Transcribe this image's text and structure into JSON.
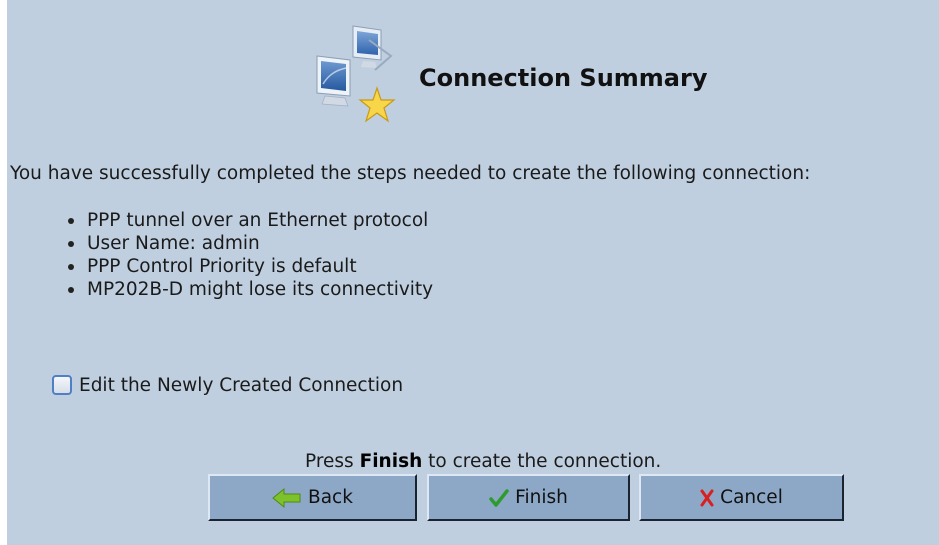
{
  "header": {
    "icon": "network-connection-wizard-icon",
    "title": "Connection Summary"
  },
  "summary": {
    "intro": "You have successfully completed the steps needed to create the following connection:",
    "items": [
      "PPP tunnel over an Ethernet protocol",
      "User Name: admin",
      "PPP Control Priority is default",
      "MP202B-D might lose its connectivity"
    ]
  },
  "edit_option": {
    "label": "Edit the Newly Created Connection",
    "checked": false
  },
  "finish_note": {
    "prefix": "Press ",
    "emphasis": "Finish",
    "suffix": " to create the connection."
  },
  "buttons": {
    "back": {
      "label": "Back",
      "icon": "back-arrow-icon"
    },
    "finish": {
      "label": "Finish",
      "icon": "check-icon"
    },
    "cancel": {
      "label": "Cancel",
      "icon": "cross-icon"
    }
  },
  "colors": {
    "panel_background": "#bfcfe0",
    "button_background": "#8da8c7",
    "checkbox_border": "#4f7fc4",
    "back_icon": "#7ec22b",
    "finish_icon": "#2f9b2f",
    "cancel_icon": "#d91f1f"
  }
}
